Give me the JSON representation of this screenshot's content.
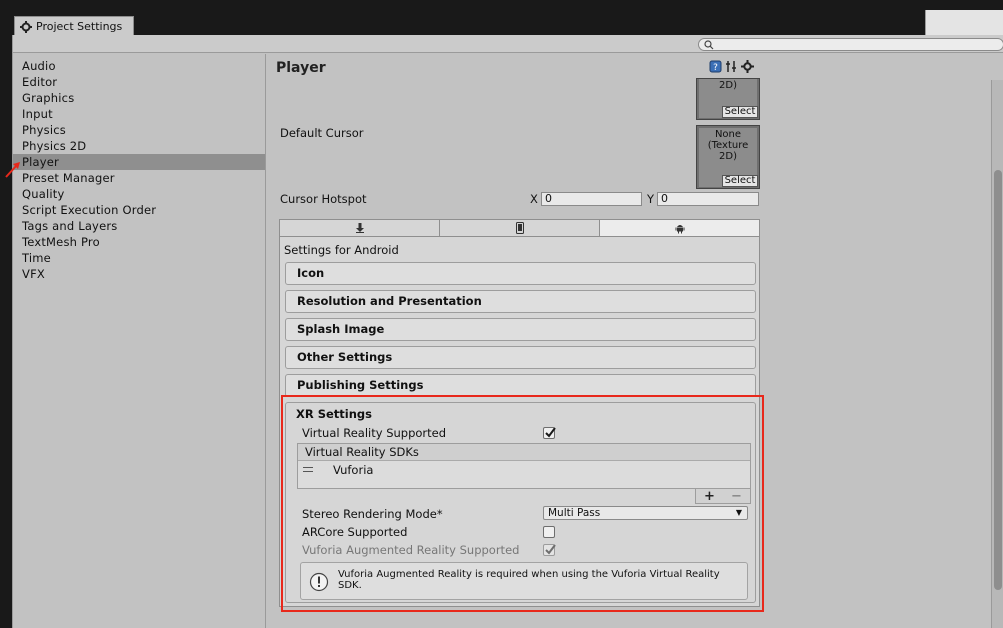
{
  "window": {
    "tab_title": "Project Settings"
  },
  "search": {
    "placeholder": ""
  },
  "sidebar": {
    "items": [
      {
        "label": "Audio"
      },
      {
        "label": "Editor"
      },
      {
        "label": "Graphics"
      },
      {
        "label": "Input"
      },
      {
        "label": "Physics"
      },
      {
        "label": "Physics 2D"
      },
      {
        "label": "Player"
      },
      {
        "label": "Preset Manager"
      },
      {
        "label": "Quality"
      },
      {
        "label": "Script Execution Order"
      },
      {
        "label": "Tags and Layers"
      },
      {
        "label": "TextMesh Pro"
      },
      {
        "label": "Time"
      },
      {
        "label": "VFX"
      }
    ],
    "selected": "Player"
  },
  "page": {
    "title": "Player"
  },
  "icon_texture": {
    "text": "2D)",
    "select_label": "Select"
  },
  "default_cursor": {
    "label": "Default Cursor",
    "texture_text_1": "None",
    "texture_text_2": "(Texture",
    "texture_text_3": "2D)",
    "select_label": "Select"
  },
  "cursor_hotspot": {
    "label": "Cursor Hotspot",
    "x_label": "X",
    "x_value": "0",
    "y_label": "Y",
    "y_value": "0"
  },
  "platform_tabs": [
    {
      "icon": "download-icon"
    },
    {
      "icon": "phone-icon"
    },
    {
      "icon": "android-icon",
      "active": true
    }
  ],
  "android": {
    "settings_for": "Settings for Android",
    "sections": {
      "icon": "Icon",
      "resolution": "Resolution and Presentation",
      "splash": "Splash Image",
      "other": "Other Settings",
      "publishing": "Publishing Settings"
    }
  },
  "xr": {
    "title": "XR Settings",
    "vr_supported_label": "Virtual Reality Supported",
    "vr_supported": true,
    "sdks_header": "Virtual Reality SDKs",
    "sdks": [
      {
        "name": "Vuforia"
      }
    ],
    "add_label": "+",
    "remove_label": "−",
    "stereo_label": "Stereo Rendering Mode*",
    "stereo_value": "Multi Pass",
    "arcore_label": "ARCore Supported",
    "arcore": false,
    "vuforia_label": "Vuforia Augmented Reality Supported",
    "vuforia": true,
    "help_text": "Vuforia Augmented Reality is required when using the Vuforia Virtual Reality SDK."
  },
  "colors": {
    "highlight_frame": "#e8281b",
    "selected_row": "#8f8f8f",
    "arrow": "#e8281b"
  }
}
